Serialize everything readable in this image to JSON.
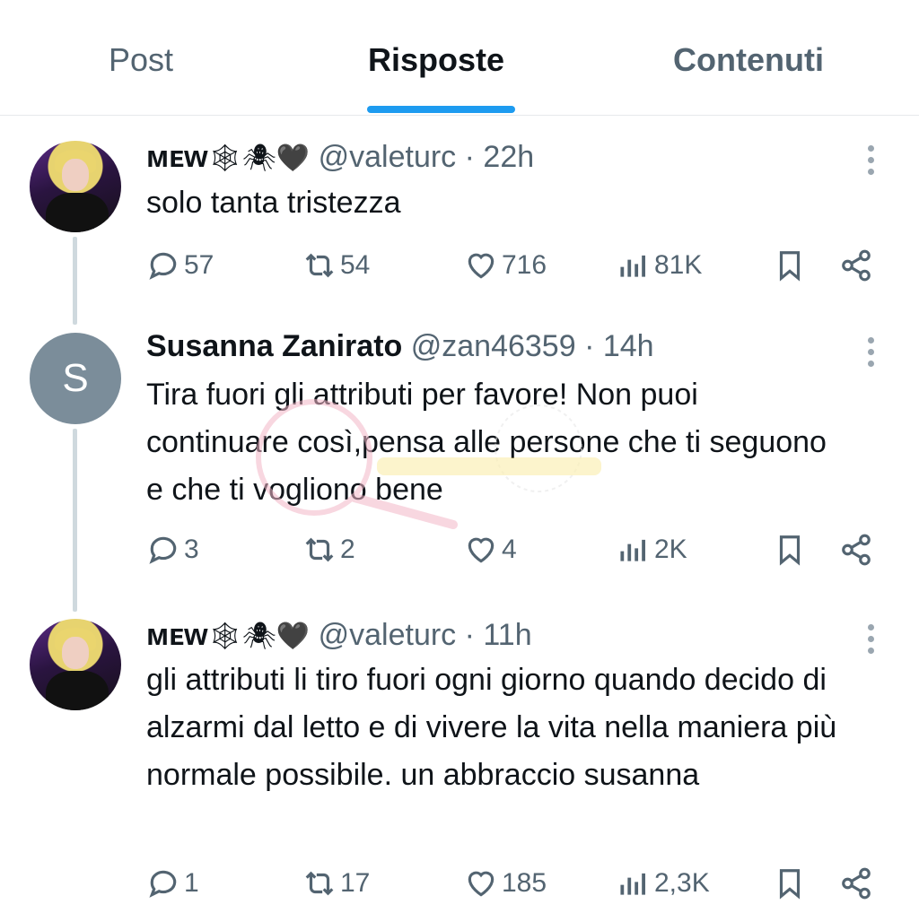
{
  "tabs": {
    "post": "Post",
    "risposte": "Risposte",
    "contenuti": "Contenuti"
  },
  "tweets": [
    {
      "name": "ᴍᴇᴡ",
      "emojis": "🕸🕷🖤",
      "handle": "@valeturc",
      "separator": "·",
      "time": "22h",
      "text": "solo tanta tristezza",
      "replies": "57",
      "retweets": "54",
      "likes": "716",
      "views": "81K"
    },
    {
      "name": "Susanna Zanirato",
      "avatar_letter": "S",
      "handle": "@zan46359",
      "separator": "·",
      "time": "14h",
      "text": "Tira fuori gli attributi per favore! Non puoi continuare così,pensa alle persone che ti seguono e che ti vogliono bene",
      "replies": "3",
      "retweets": "2",
      "likes": "4",
      "views": "2K"
    },
    {
      "name": "ᴍᴇᴡ",
      "emojis": "🕸🕷🖤",
      "handle": "@valeturc",
      "separator": "·",
      "time": "11h",
      "text": "gli attributi li tiro fuori ogni giorno quando decido di alzarmi dal letto e di vivere la vita nella maniera più normale possibile. un abbraccio susanna",
      "replies": "1",
      "retweets": "17",
      "likes": "185",
      "views": "2,3K"
    }
  ],
  "colors": {
    "accent": "#1d9bf0",
    "secondary_text": "#536471",
    "thread_line": "#cfd9de"
  },
  "icons": [
    "reply-icon",
    "retweet-icon",
    "like-icon",
    "views-icon",
    "bookmark-icon",
    "share-icon",
    "more-icon"
  ]
}
